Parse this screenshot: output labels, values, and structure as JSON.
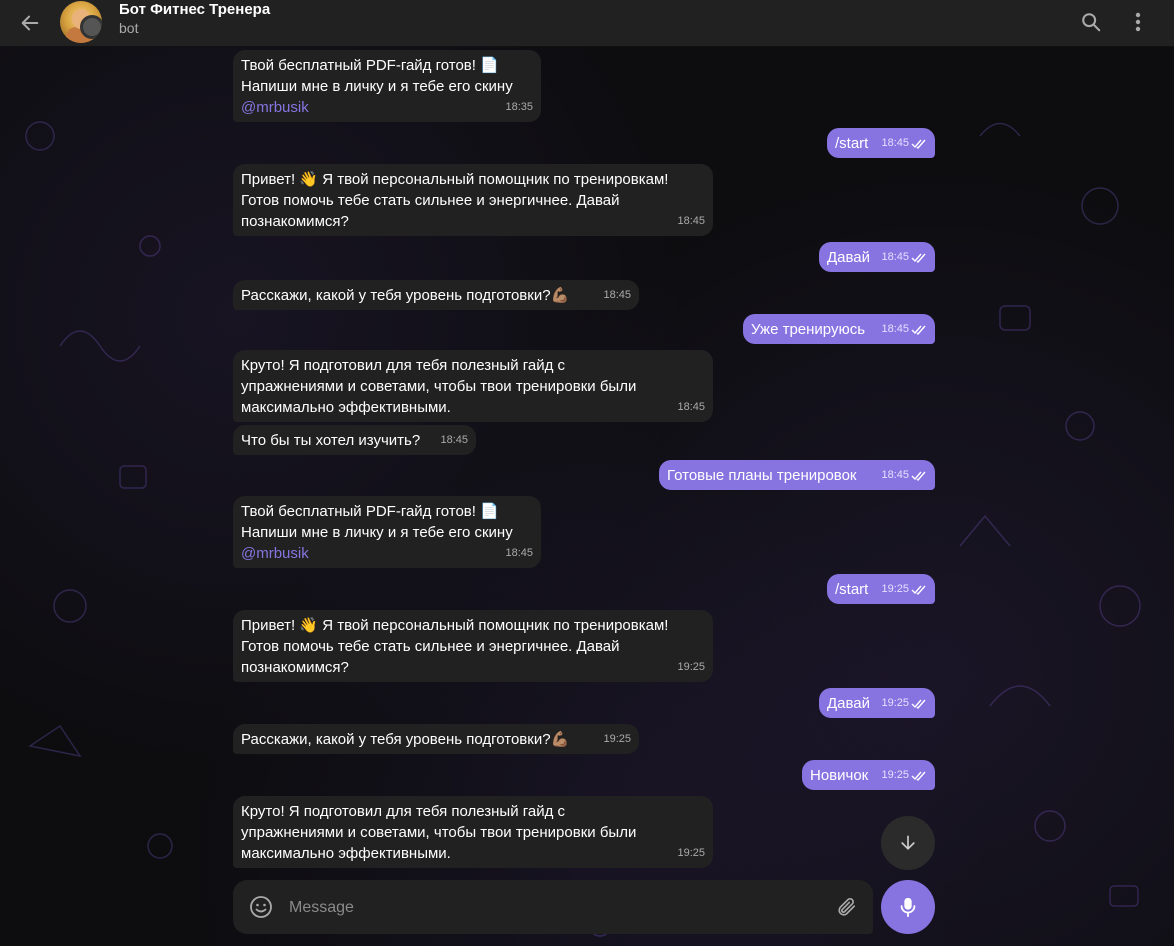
{
  "header": {
    "title": "Бот Фитнес Тренера",
    "subtitle": "bot"
  },
  "messages": [
    {
      "id": "m1",
      "dir": "in",
      "lines": [
        "Твой бесплатный PDF-гайд готов! 📄",
        "Напиши мне в личку и я тебе его скину"
      ],
      "link": "@mrbusik",
      "time": "18:35"
    },
    {
      "id": "m2",
      "dir": "out",
      "text": "/start",
      "time": "18:45"
    },
    {
      "id": "m3",
      "dir": "in",
      "lines": [
        "Привет! 👋 Я твой персональный помощник по тренировкам!",
        "Готов помочь тебе стать сильнее и энергичнее. Давай",
        "познакомимся?"
      ],
      "time": "18:45"
    },
    {
      "id": "m4",
      "dir": "out",
      "text": "Давай",
      "time": "18:45"
    },
    {
      "id": "m5",
      "dir": "in",
      "text": "Расскажи, какой у тебя уровень подготовки?💪🏽",
      "time": "18:45"
    },
    {
      "id": "m6",
      "dir": "out",
      "text": "Уже тренируюсь",
      "time": "18:45"
    },
    {
      "id": "m7",
      "dir": "in",
      "lines": [
        "Круто! Я подготовил для тебя полезный гайд с",
        "упражнениями и советами, чтобы твои тренировки были",
        "максимально эффективными."
      ],
      "time": "18:45"
    },
    {
      "id": "m8",
      "dir": "in",
      "text": "Что бы ты хотел изучить?",
      "time": "18:45"
    },
    {
      "id": "m9",
      "dir": "out",
      "text": "Готовые планы тренировок",
      "time": "18:45"
    },
    {
      "id": "m10",
      "dir": "in",
      "lines": [
        "Твой бесплатный PDF-гайд готов! 📄",
        "Напиши мне в личку и я тебе его скину"
      ],
      "link": "@mrbusik",
      "time": "18:45"
    },
    {
      "id": "m11",
      "dir": "out",
      "text": "/start",
      "time": "19:25"
    },
    {
      "id": "m12",
      "dir": "in",
      "lines": [
        "Привет! 👋 Я твой персональный помощник по тренировкам!",
        "Готов помочь тебе стать сильнее и энергичнее. Давай",
        "познакомимся?"
      ],
      "time": "19:25"
    },
    {
      "id": "m13",
      "dir": "out",
      "text": "Давай",
      "time": "19:25"
    },
    {
      "id": "m14",
      "dir": "in",
      "text": "Расскажи, какой у тебя уровень подготовки?💪🏽",
      "time": "19:25"
    },
    {
      "id": "m15",
      "dir": "out",
      "text": "Новичок",
      "time": "19:25"
    },
    {
      "id": "m16",
      "dir": "in",
      "lines": [
        "Круто! Я подготовил для тебя полезный гайд с",
        "упражнениями и советами, чтобы твои тренировки были",
        "максимально эффективными."
      ],
      "time": "19:25"
    }
  ],
  "composer": {
    "placeholder": "Message"
  },
  "colors": {
    "accent": "#8774e1",
    "incoming_bubble": "#212121",
    "header_bg": "#212121",
    "background": "#0e0e10"
  },
  "icons": {
    "back": "arrow-left-icon",
    "search": "search-icon",
    "more": "more-vertical-icon",
    "scroll_down": "arrow-down-icon",
    "emoji": "smile-icon",
    "attach": "paperclip-icon",
    "mic": "microphone-icon"
  }
}
